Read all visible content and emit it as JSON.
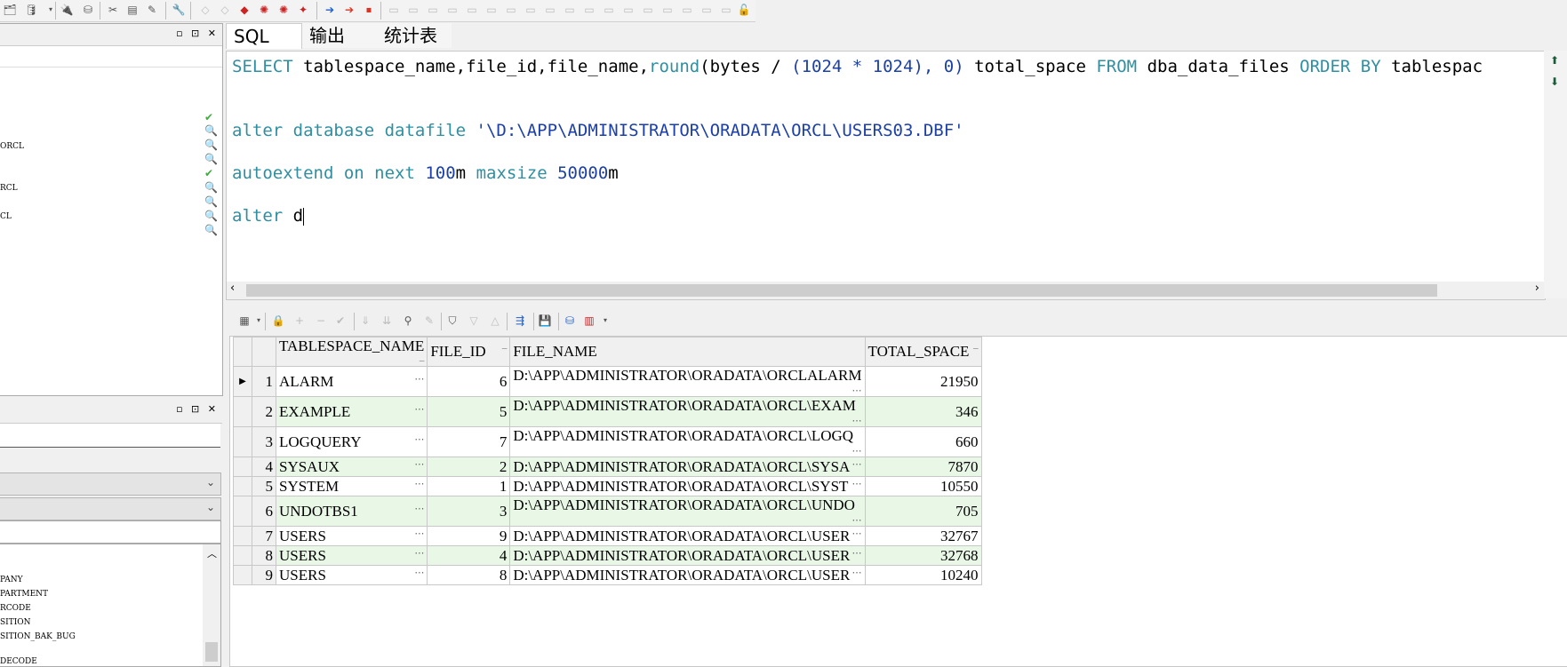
{
  "tabs": [
    "SQL",
    "输出",
    "统计表"
  ],
  "sql_lines": [
    [
      {
        "t": "kw",
        "v": "SELECT"
      },
      {
        "t": "pl",
        "v": " tablespace_name,file_id,file_name,"
      },
      {
        "t": "fn",
        "v": "round"
      },
      {
        "t": "pl",
        "v": "(bytes / "
      },
      {
        "t": "nm",
        "v": "(1024 * 1024), 0)"
      },
      {
        "t": "pl",
        "v": " total_space "
      },
      {
        "t": "kw",
        "v": "FROM"
      },
      {
        "t": "pl",
        "v": " dba_data_files "
      },
      {
        "t": "kw",
        "v": "ORDER BY"
      },
      {
        "t": "pl",
        "v": " tablespac"
      }
    ],
    [
      {
        "t": "kw",
        "v": "alter database datafile "
      },
      {
        "t": "str",
        "v": "'\\D:\\APP\\ADMINISTRATOR\\ORADATA\\ORCL\\USERS03.DBF'"
      }
    ],
    [
      {
        "t": "kw",
        "v": "autoextend on next "
      },
      {
        "t": "nm",
        "v": "100"
      },
      {
        "t": "pl",
        "v": "m "
      },
      {
        "t": "kw",
        "v": "maxsize "
      },
      {
        "t": "nm",
        "v": "50000"
      },
      {
        "t": "pl",
        "v": "m"
      }
    ],
    [
      {
        "t": "kw",
        "v": "alter "
      },
      {
        "t": "pl",
        "v": "d"
      }
    ]
  ],
  "left_tree": [
    "ORCL",
    "RCL",
    "CL"
  ],
  "left_list": [
    "PANY",
    "PARTMENT",
    "RCODE",
    "SITION",
    "SITION_BAK_BUG",
    "DECODE"
  ],
  "grid": {
    "columns": [
      "TABLESPACE_NAME",
      "FILE_ID",
      "FILE_NAME",
      "TOTAL_SPACE"
    ],
    "rows": [
      [
        "1",
        "ALARM",
        "6",
        "D:\\APP\\ADMINISTRATOR\\ORADATA\\ORCLALARM",
        "21950"
      ],
      [
        "2",
        "EXAMPLE",
        "5",
        "D:\\APP\\ADMINISTRATOR\\ORADATA\\ORCL\\EXAM",
        "346"
      ],
      [
        "3",
        "LOGQUERY",
        "7",
        "D:\\APP\\ADMINISTRATOR\\ORADATA\\ORCL\\LOGQ",
        "660"
      ],
      [
        "4",
        "SYSAUX",
        "2",
        "D:\\APP\\ADMINISTRATOR\\ORADATA\\ORCL\\SYSA",
        "7870"
      ],
      [
        "5",
        "SYSTEM",
        "1",
        "D:\\APP\\ADMINISTRATOR\\ORADATA\\ORCL\\SYST",
        "10550"
      ],
      [
        "6",
        "UNDOTBS1",
        "3",
        "D:\\APP\\ADMINISTRATOR\\ORADATA\\ORCL\\UNDO",
        "705"
      ],
      [
        "7",
        "USERS",
        "9",
        "D:\\APP\\ADMINISTRATOR\\ORADATA\\ORCL\\USER",
        "32767"
      ],
      [
        "8",
        "USERS",
        "4",
        "D:\\APP\\ADMINISTRATOR\\ORADATA\\ORCL\\USER",
        "32768"
      ],
      [
        "9",
        "USERS",
        "8",
        "D:\\APP\\ADMINISTRATOR\\ORADATA\\ORCL\\USER",
        "10240"
      ]
    ]
  },
  "colors": {
    "keyword": "#2f8fa1",
    "number": "#1c3fa8",
    "row_alt": "#e8f7e6"
  }
}
